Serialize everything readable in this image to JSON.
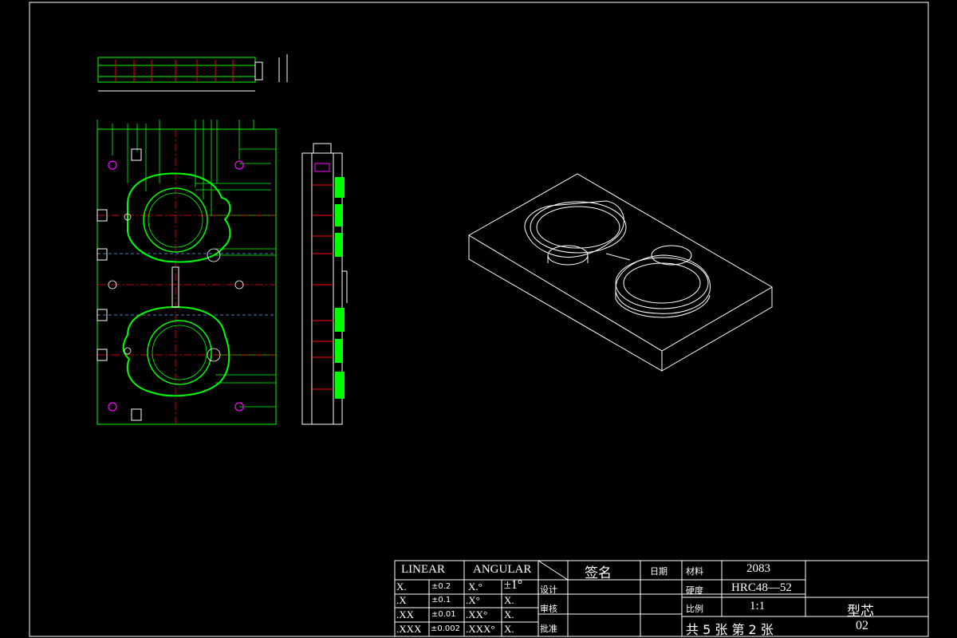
{
  "title_block": {
    "tolerance": {
      "linear_header": "LINEAR",
      "angular_header": "ANGULAR",
      "rows": [
        {
          "lin": "X.",
          "lin_tol": "±0.2",
          "ang": "X.°",
          "ang_tol": "±1°"
        },
        {
          "lin": ".X",
          "lin_tol": "±0.1",
          "ang": ".X°",
          "ang_tol": "X."
        },
        {
          "lin": ".XX",
          "lin_tol": "±0.01",
          "ang": ".XX°",
          "ang_tol": "X."
        },
        {
          "lin": ".XXX",
          "lin_tol": "±0.002",
          "ang": ".XXX°",
          "ang_tol": "X."
        }
      ]
    },
    "signature_header": "签名",
    "date_header": "日期",
    "roles": [
      "设计",
      "审核",
      "批准"
    ],
    "material_label": "材料",
    "material_value": "2083",
    "hardness_label": "硬度",
    "hardness_value": "HRC48—52",
    "scale_label": "比例",
    "scale_value": "1:1",
    "sheet_text": "共 5 张 第 2 张",
    "part_name": "型芯",
    "drawing_number": "02"
  },
  "colors": {
    "background": "#000000",
    "border": "#ffffff",
    "geometry_green": "#00ff00",
    "centerline_red": "#ff0000",
    "hole_magenta": "#ff00ff",
    "iso_white": "#ffffff"
  }
}
